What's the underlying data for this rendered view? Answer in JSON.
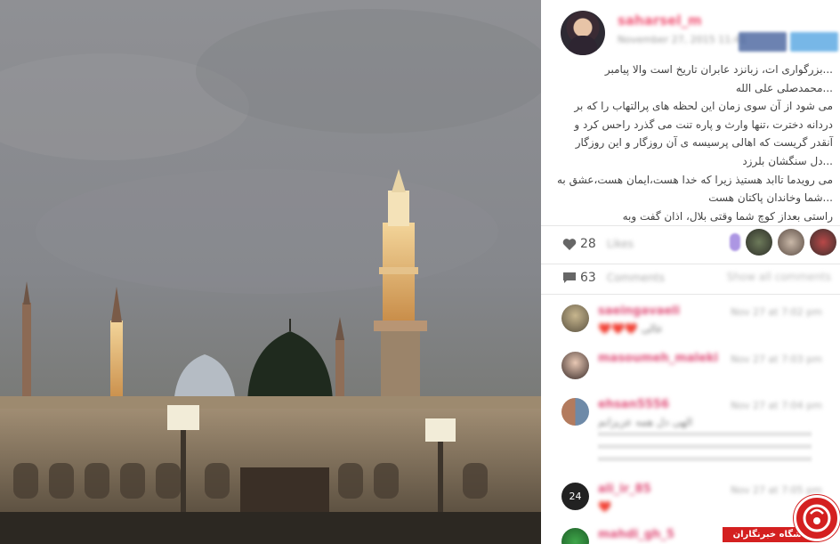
{
  "post": {
    "username": "saharsel_m",
    "date": "November 27, 2015 11:41",
    "caption_lines": [
      "...بزرگواری ات، زبانزد عابران تاریخ است والا پیامبر",
      "...محمدصلی علی الله",
      "می شود از آن سوی زمان این لحظه های پرالتهاب را که بر",
      "دردانه دخترت ،تنها وارث و پاره تنت می گذرد راحس کرد و",
      "آنقدر گریست که اهالی پرسیسه ی آن روزگار و این روزگار",
      "...دل سنگشان بلرزد",
      "می رویدما تاابد هستیذ زیرا که خدا هست،ایمان هست،عشق به",
      "...شما وخاندان پاکتان هست",
      "راستی بعداز کوچ شما وقتی بلال، اذان گفت وبه"
    ]
  },
  "stats": {
    "likes_count": "28",
    "likes_label": "Likes",
    "comments_count": "63",
    "comments_label": "Comments",
    "show_all_label": "Show all comments"
  },
  "comments": [
    {
      "user": "saeingavaeli",
      "time": "Nov 27 at 7:02 pm",
      "text": "❤️❤️❤️ عالی"
    },
    {
      "user": "masoumeh_maleki",
      "time": "Nov 27 at 7:03 pm",
      "text": ""
    },
    {
      "user": "ehsan5556",
      "time": "Nov 27 at 7:04 pm",
      "text": "الهی دل همه عزیزانم"
    },
    {
      "user": "ali_ir_85",
      "time": "Nov 27 at 7:05 pm",
      "text": "❤️"
    },
    {
      "user": "mahdi_gh_5",
      "time": "Nov 27 at 7:06 pm",
      "text": ""
    }
  ],
  "watermark": {
    "label": "باشگاه خبرنگاران",
    "color": "#d42020"
  },
  "icons": {
    "like": "heart-icon",
    "comment": "comment-icon"
  }
}
